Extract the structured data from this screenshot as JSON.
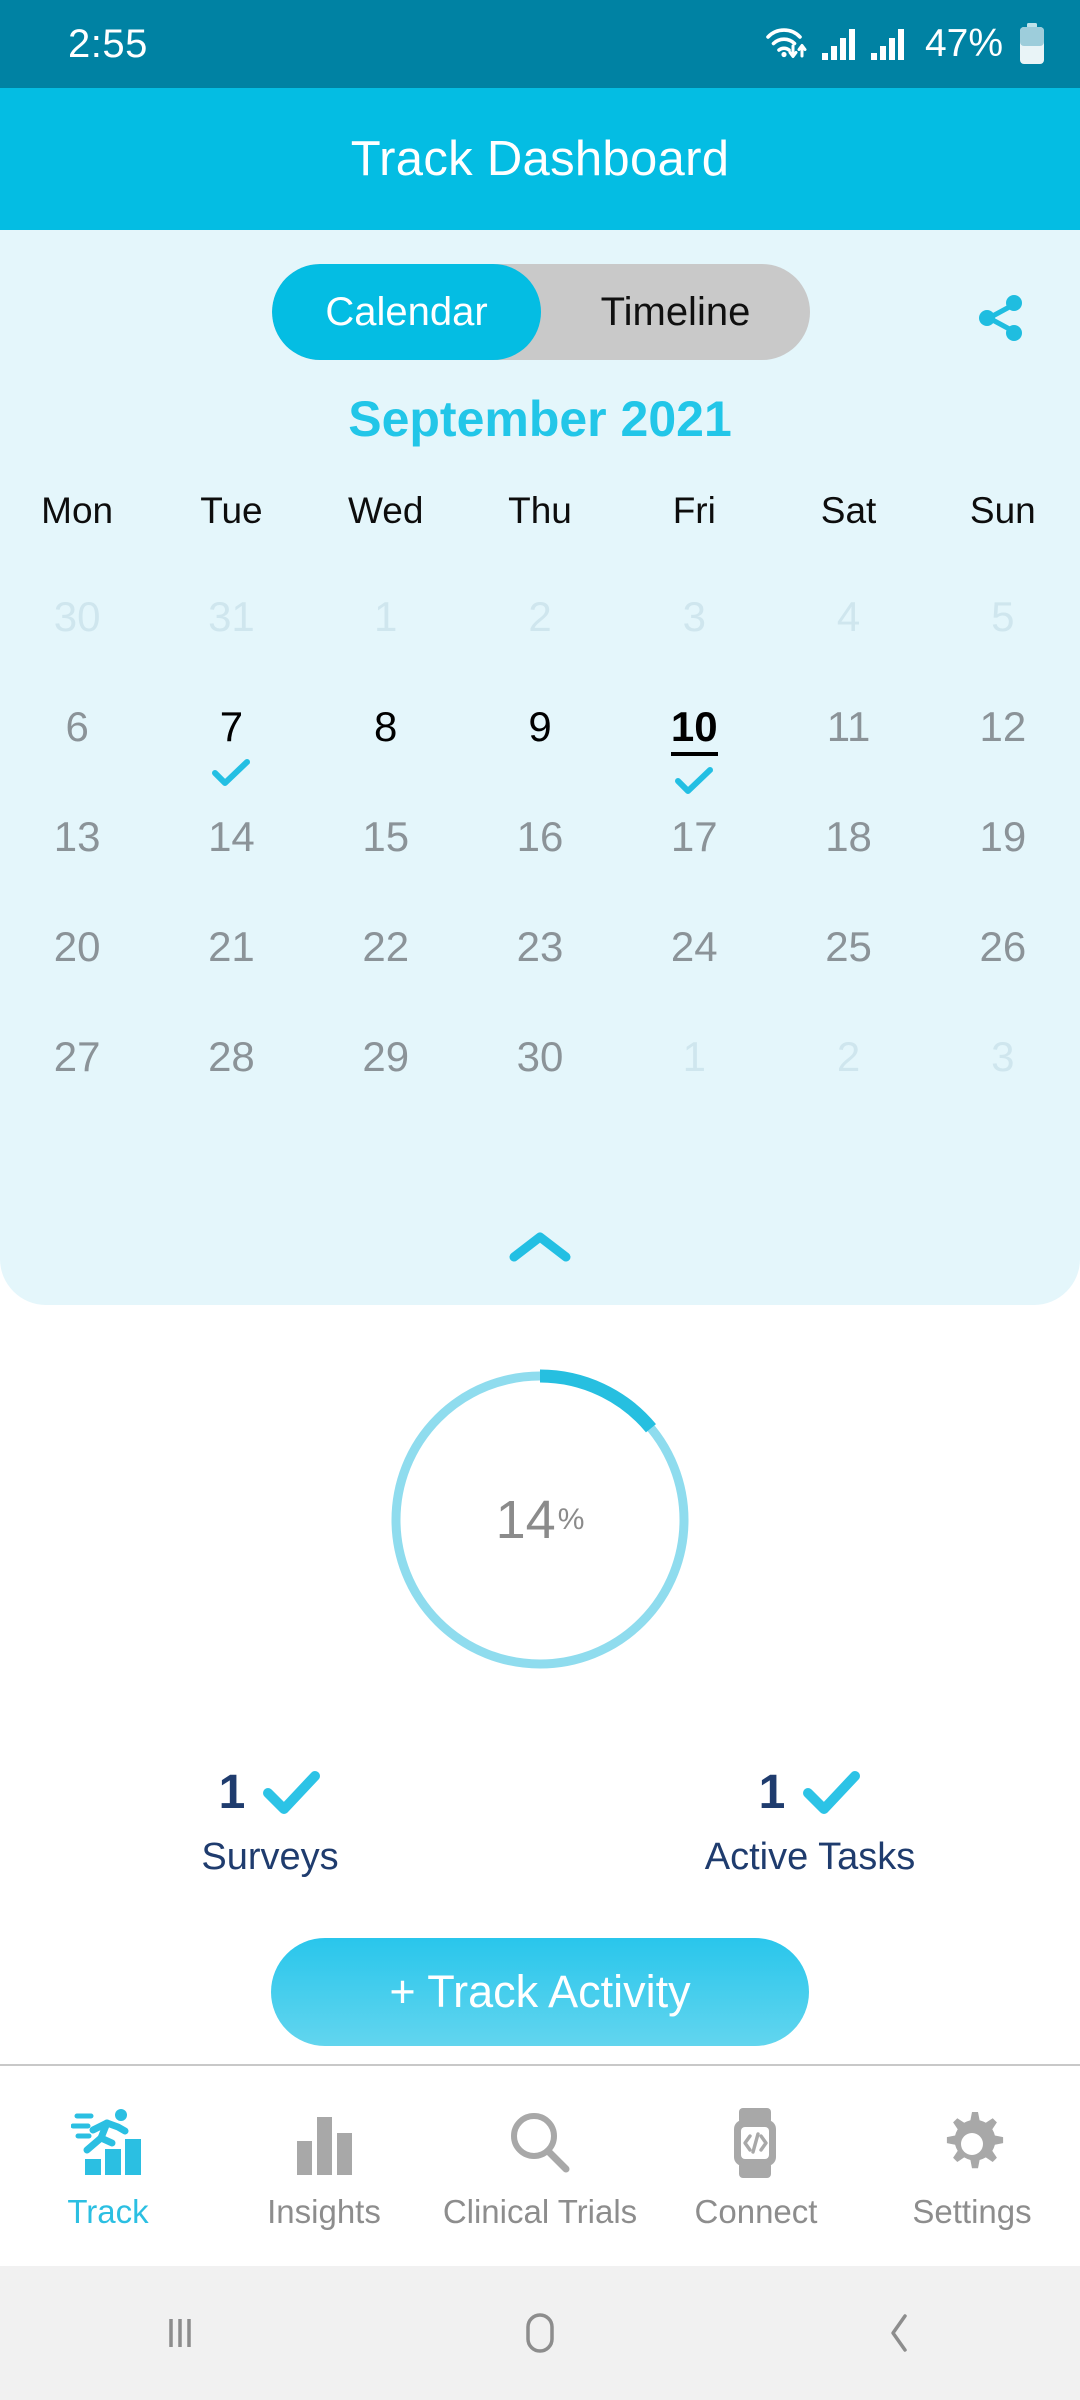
{
  "status_bar": {
    "clock": "2:55",
    "battery_percent": "47%",
    "icons": [
      "wifi-data-icon",
      "signal-icon",
      "signal-icon",
      "battery-icon"
    ]
  },
  "app_bar": {
    "title": "Track Dashboard"
  },
  "view_toggle": {
    "options": [
      "Calendar",
      "Timeline"
    ],
    "selected": "Calendar"
  },
  "share_button": {
    "icon": "share-icon"
  },
  "calendar": {
    "month_title": "September 2021",
    "weekdays": [
      "Mon",
      "Tue",
      "Wed",
      "Thu",
      "Fri",
      "Sat",
      "Sun"
    ],
    "collapse_icon": "chevron-up-icon",
    "weeks": [
      [
        {
          "num": "30",
          "state": "prev"
        },
        {
          "num": "31",
          "state": "prev"
        },
        {
          "num": "1",
          "state": "prev"
        },
        {
          "num": "2",
          "state": "prev"
        },
        {
          "num": "3",
          "state": "prev"
        },
        {
          "num": "4",
          "state": "prev"
        },
        {
          "num": "5",
          "state": "prev"
        }
      ],
      [
        {
          "num": "6",
          "state": "current"
        },
        {
          "num": "7",
          "state": "active",
          "check": true
        },
        {
          "num": "8",
          "state": "active"
        },
        {
          "num": "9",
          "state": "active"
        },
        {
          "num": "10",
          "state": "today",
          "check": true
        },
        {
          "num": "11",
          "state": "current"
        },
        {
          "num": "12",
          "state": "current"
        }
      ],
      [
        {
          "num": "13",
          "state": "current"
        },
        {
          "num": "14",
          "state": "current"
        },
        {
          "num": "15",
          "state": "current"
        },
        {
          "num": "16",
          "state": "current"
        },
        {
          "num": "17",
          "state": "current"
        },
        {
          "num": "18",
          "state": "current"
        },
        {
          "num": "19",
          "state": "current"
        }
      ],
      [
        {
          "num": "20",
          "state": "current"
        },
        {
          "num": "21",
          "state": "current"
        },
        {
          "num": "22",
          "state": "current"
        },
        {
          "num": "23",
          "state": "current"
        },
        {
          "num": "24",
          "state": "current"
        },
        {
          "num": "25",
          "state": "current"
        },
        {
          "num": "26",
          "state": "current"
        }
      ],
      [
        {
          "num": "27",
          "state": "current"
        },
        {
          "num": "28",
          "state": "current"
        },
        {
          "num": "29",
          "state": "current"
        },
        {
          "num": "30",
          "state": "current"
        },
        {
          "num": "1",
          "state": "next"
        },
        {
          "num": "2",
          "state": "next"
        },
        {
          "num": "3",
          "state": "next"
        }
      ]
    ]
  },
  "progress_ring": {
    "value": "14",
    "unit": "%",
    "percent": 14,
    "track_color": "#8fdcee",
    "arc_color": "#26bfe0"
  },
  "stats": [
    {
      "value": "1",
      "label": "Surveys",
      "icon": "check-icon"
    },
    {
      "value": "1",
      "label": "Active Tasks",
      "icon": "check-icon"
    }
  ],
  "cta": {
    "label": "+ Track Activity"
  },
  "bottom_nav": {
    "items": [
      {
        "label": "Track",
        "icon": "running-chart-icon",
        "active": true
      },
      {
        "label": "Insights",
        "icon": "bar-chart-icon",
        "active": false
      },
      {
        "label": "Clinical Trials",
        "icon": "search-icon",
        "active": false
      },
      {
        "label": "Connect",
        "icon": "smartwatch-code-icon",
        "active": false
      },
      {
        "label": "Settings",
        "icon": "gear-icon",
        "active": false
      }
    ]
  },
  "system_nav": {
    "buttons": [
      "recents-icon",
      "home-icon",
      "back-icon"
    ]
  },
  "colors": {
    "status_bar": "#0082a3",
    "app_bar": "#04bde3",
    "accent": "#04bde3",
    "card_bg": "#e4f6fb",
    "stat_text": "#1f3c6e"
  }
}
